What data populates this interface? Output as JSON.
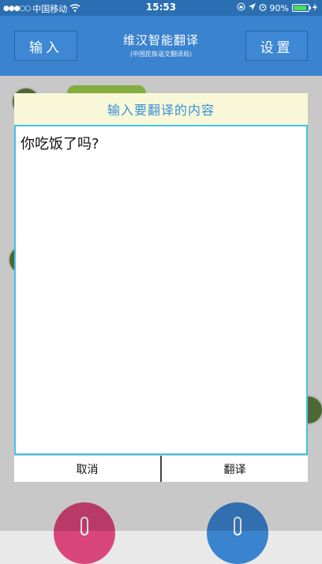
{
  "status_bar": {
    "signal": "●●●○○",
    "carrier": "中国移动",
    "time": "15:53",
    "battery_percent": "90%",
    "battery_level": 0.9
  },
  "header": {
    "input_button": "输入",
    "title": "维汉智能翻译",
    "subtitle": "(中国民族语文翻译局)",
    "settings_button": "设置"
  },
  "dialog": {
    "title": "输入要翻译的内容",
    "text_value": "你吃饭了吗?",
    "cancel_label": "取消",
    "translate_label": "翻译"
  },
  "colors": {
    "header_bg": "#3a83cf",
    "dialog_title_bg": "#f8f8d8",
    "dialog_title_text": "#3a8fd6",
    "text_border": "#3fc3e6",
    "mic_left": "#d9467a",
    "mic_right": "#3a83cf"
  }
}
